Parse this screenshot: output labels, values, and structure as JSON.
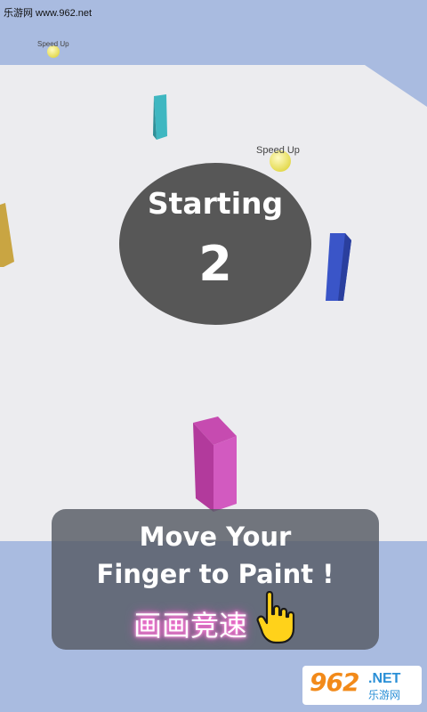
{
  "watermark_top": "乐游网 www.962.net",
  "speed_up_labels": [
    "Speed Up",
    "Speed Up"
  ],
  "countdown": {
    "label": "Starting",
    "number": "2"
  },
  "instruction": {
    "line1": "Move Your",
    "line2": "Finger to Paint !"
  },
  "overlay_text": "画画竞速",
  "watermark_logo": {
    "number": "962",
    "net": ".NET",
    "site": "乐游网"
  },
  "colors": {
    "sky": "#a9bbe0",
    "floor": "#ececef",
    "countdown_bg": "#575757",
    "panel_bg": "#555a64",
    "block_teal": "#3fb7c1",
    "block_gold": "#c9a542",
    "block_blue": "#3a55c8",
    "block_magenta": "#c23eaa",
    "ball_yellow": "#f0ea6a"
  }
}
